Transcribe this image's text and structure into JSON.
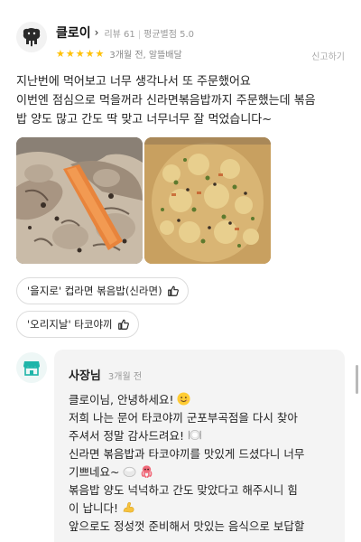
{
  "review": {
    "reviewer_name": "클로이",
    "review_count": "리뷰 61",
    "average_rating": "평균별점 5.0",
    "stars": 5,
    "time_ago": "3개월 전",
    "delivery": "알뜰배달",
    "report_label": "신고하기",
    "text_lines": [
      "지난번에 먹어보고 너무 생각나서 또 주문했어요",
      "이번엔 점심으로 먹을꺼라 신라면볶음밥까지 주문했는데 볶음",
      "밥 양도 많고 간도 딱 맞고 너무너무 잘 먹었습니다~"
    ],
    "menu_chips": [
      {
        "label": "'을지로' 컵라면 볶음밥(신라면)"
      },
      {
        "label": "'오리지날' 타코야끼"
      }
    ]
  },
  "reply": {
    "owner_name": "사장님",
    "time_ago": "3개월 전",
    "lines": [
      "클로이님, 안녕하세요! ",
      "저희 나는 문어 타코야끼 군포부곡점을 다시 찾아",
      "주셔서 정말 감사드려요! ",
      "신라면 볶음밥과 타코야끼를 맛있게 드셨다니 너무",
      "기쁘네요~ ",
      "볶음밥 양도 넉넉하고 간도 맞았다고 해주시니 힘",
      "이 납니다! ",
      "앞으로도 정성껏 준비해서 맛있는 음식으로 보답할"
    ]
  },
  "colors": {
    "star": "#ffc107",
    "reply_bg": "#f4f4f4",
    "chip_border": "#dcdcdc"
  },
  "icons": [
    "elephant-avatar-icon",
    "chevron-right-icon",
    "star-icon",
    "thumbs-up-icon",
    "store-icon",
    "smile-emoji-icon",
    "plate-emoji-icon",
    "rice-ball-emoji-icon",
    "octopus-emoji-icon",
    "flexed-arm-emoji-icon"
  ]
}
